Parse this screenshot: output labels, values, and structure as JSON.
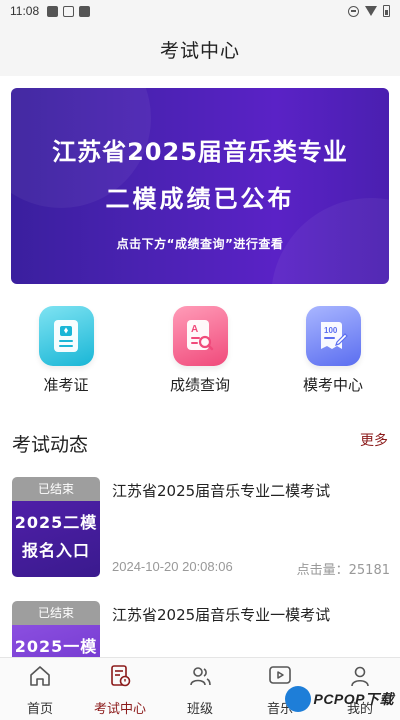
{
  "status_bar": {
    "time": "11:08"
  },
  "header": {
    "title": "考试中心"
  },
  "banner": {
    "line1": "江苏省2025届音乐类专业",
    "line2": "二模成绩已公布",
    "line3": "点击下方“成绩查询”进行查看"
  },
  "quick_actions": [
    {
      "label": "准考证",
      "icon": "admission-ticket-icon"
    },
    {
      "label": "成绩查询",
      "icon": "score-search-icon"
    },
    {
      "label": "模考中心",
      "icon": "mock-exam-icon"
    }
  ],
  "section": {
    "title": "考试动态",
    "more": "更多"
  },
  "exams": [
    {
      "status": "已结束",
      "thumb_line1": "2025二模",
      "thumb_line2": "报名入口",
      "title": "江苏省2025届音乐专业二模考试",
      "date": "2024-10-20 20:08:06",
      "clicks": "点击量：25181"
    },
    {
      "status": "已结束",
      "thumb_line1": "2025一模",
      "thumb_line2": "",
      "title": "江苏省2025届音乐专业一模考试"
    }
  ],
  "tabbar": {
    "items": [
      {
        "label": "首页",
        "icon": "home-icon"
      },
      {
        "label": "考试中心",
        "icon": "exam-center-icon",
        "active": true
      },
      {
        "label": "班级",
        "icon": "class-icon"
      },
      {
        "label": "音乐",
        "icon": "music-video-icon"
      },
      {
        "label": "我的",
        "icon": "profile-icon"
      }
    ]
  },
  "watermark": {
    "text": "PCPOP下载"
  },
  "colors": {
    "accent": "#8b1a1a",
    "banner": "#4a22b2"
  }
}
